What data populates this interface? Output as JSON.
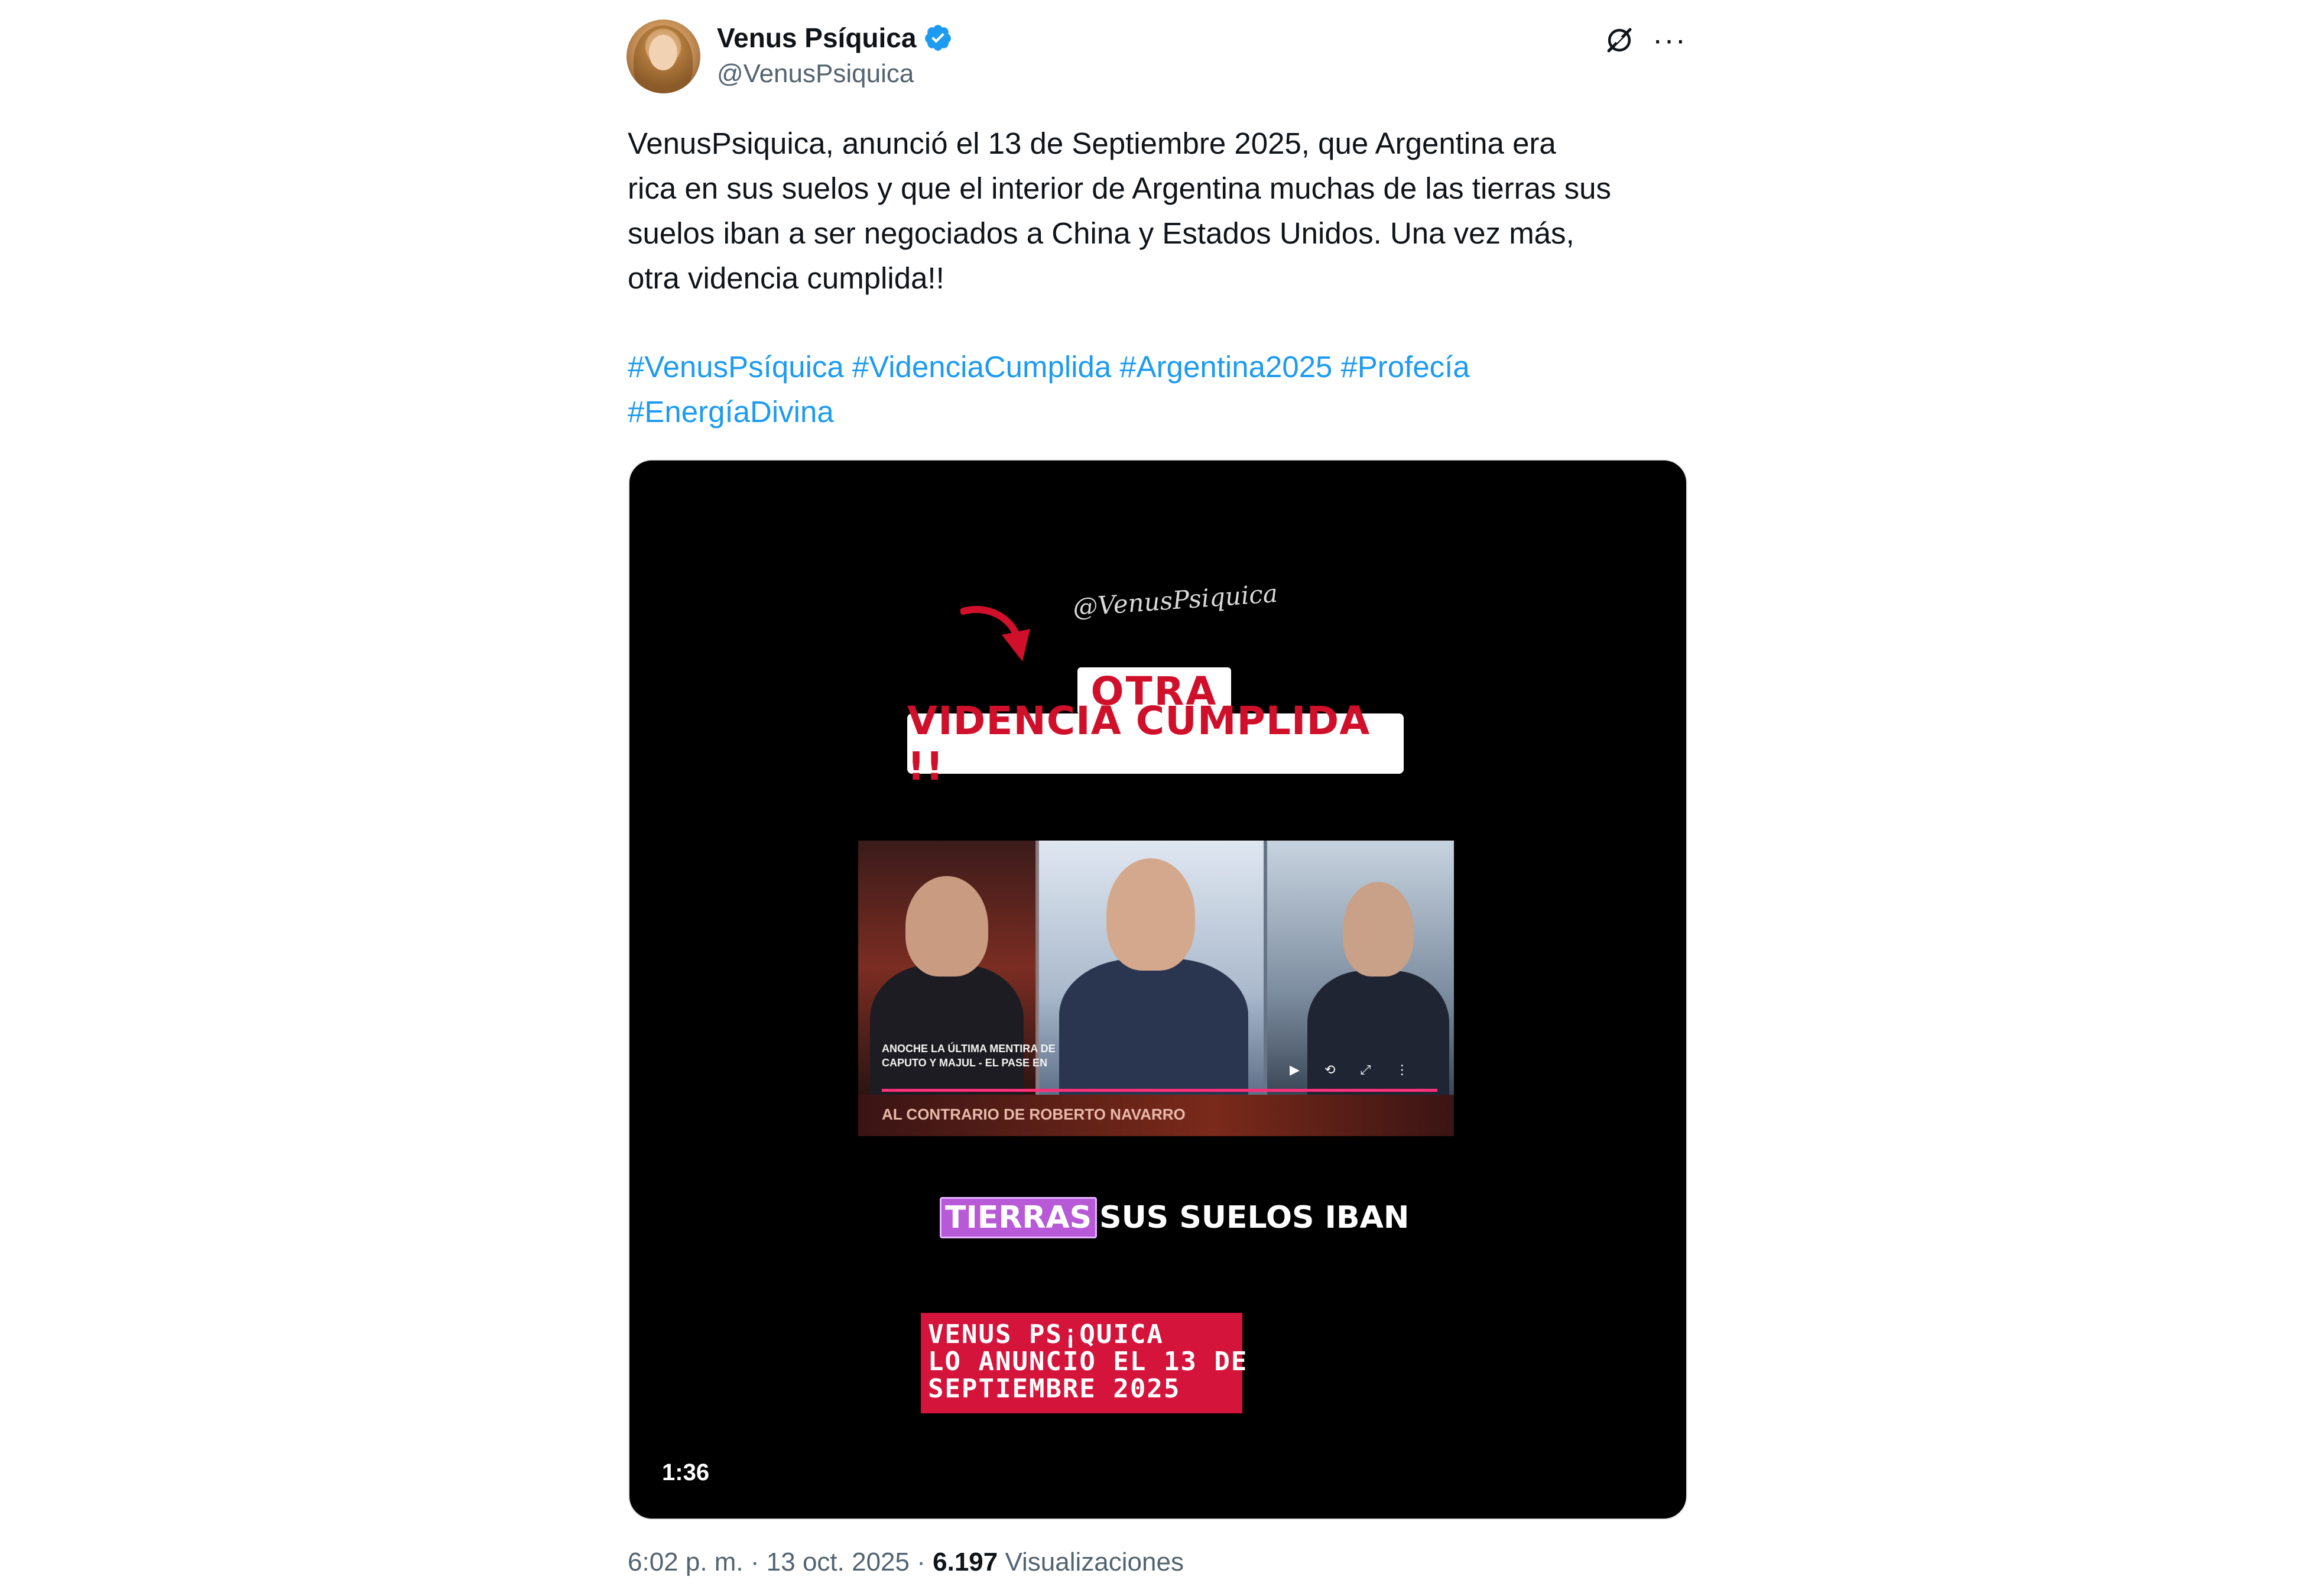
{
  "author": {
    "display_name": "Venus Psíquica",
    "handle": "@VenusPsiquica",
    "verified": true,
    "verified_color": "#1d9bf0",
    "avatar_icon": "avatar"
  },
  "actions": {
    "grok_icon": "grok-icon",
    "more_label": "···"
  },
  "tweet": {
    "text": "VenusPsiquica, anunció el 13 de Septiembre 2025, que Argentina era\nrica en sus suelos y que el interior de Argentina muchas de las tierras sus\nsuelos iban a ser negociados a China y Estados Unidos. Una vez más,\notra videncia cumplida!!",
    "hashtags": [
      "#VenusPsíquica",
      "#VidenciaCumplida",
      "#Argentina2025",
      "#Profecía",
      "#EnergíaDivina"
    ],
    "link_color": "#1d9bf0"
  },
  "video": {
    "watermark": "@VenusPsiquica",
    "banner_line1": "OTRA",
    "banner_line2": "VIDENCIA CUMPLIDA !!",
    "clip_chyron": "AL CONTRARIO DE ROBERTO NAVARRO",
    "clip_caption": "ANOCHE LA ÚLTIMA MENTIRA DE CAPUTO Y MAJUL - EL PASE EN",
    "subtitle_highlight": "TIERRAS",
    "subtitle_rest": "SUS SUELOS IBAN",
    "box_lines": [
      "VENUS PS¡QUICA",
      "LO ANUNCIO EL 13 DE",
      "SEPTIEMBRE 2025"
    ],
    "duration": "1:36",
    "accent_red": "#d4143b",
    "highlight_purple": "#b85ad8"
  },
  "meta": {
    "time": "6:02 p. m.",
    "separator": "·",
    "date": "13 oct. 2025",
    "views_count": "6.197",
    "views_label": "Visualizaciones"
  }
}
